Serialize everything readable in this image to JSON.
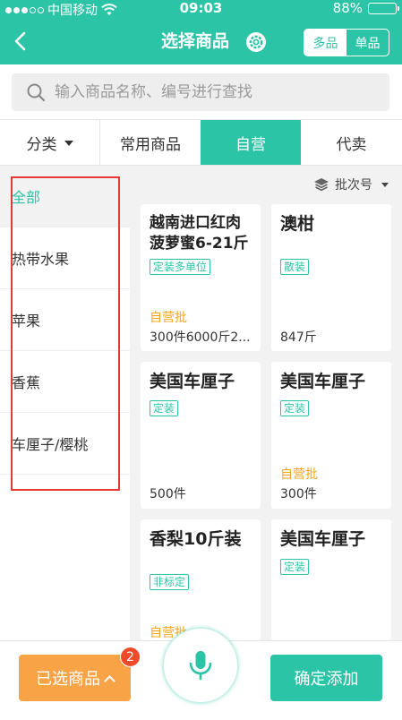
{
  "status_bar": {
    "carrier": "中国移动",
    "time": "09:03",
    "battery": "88%",
    "battery_level": 0.88
  },
  "nav": {
    "title": "选择商品",
    "mode_multi": "多品",
    "mode_single": "单品",
    "active_mode": "多品"
  },
  "search": {
    "placeholder": "输入商品名称、编号进行查找"
  },
  "tabs": {
    "category": "分类",
    "common": "常用商品",
    "self_operated": "自营",
    "agent": "代卖",
    "active": "自营"
  },
  "sidebar": {
    "items": [
      {
        "label": "全部"
      },
      {
        "label": "热带水果"
      },
      {
        "label": "苹果"
      },
      {
        "label": "香蕉"
      },
      {
        "label": "车厘子/樱桃"
      }
    ],
    "active_index": 0
  },
  "batch": {
    "label": "批次号"
  },
  "products": [
    {
      "name": "越南进口红肉菠萝蜜6-21斤",
      "tag": "定装多单位",
      "label": "自营批",
      "qty": "300件6000斤2..."
    },
    {
      "name": "澳柑",
      "tag": "散装",
      "label": "",
      "qty": "847斤"
    },
    {
      "name": "美国车厘子",
      "tag": "定装",
      "label": "",
      "qty": "500件"
    },
    {
      "name": "美国车厘子",
      "tag": "定装",
      "label": "自营批",
      "qty": "300件"
    },
    {
      "name": "香梨10斤装",
      "tag": "非标定",
      "label": "自营批",
      "qty": ""
    },
    {
      "name": "美国车厘子",
      "tag": "定装",
      "label": "",
      "qty": ""
    }
  ],
  "bottom": {
    "selected_label": "已选商品",
    "selected_count": "2",
    "confirm_label": "确定添加"
  },
  "colors": {
    "primary": "#2bc4a6",
    "orange": "#f9a347",
    "badge": "#f04a2a",
    "annotation": "#e53935"
  }
}
